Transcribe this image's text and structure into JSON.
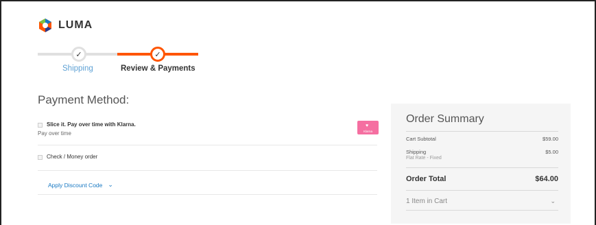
{
  "brand": {
    "name": "LUMA",
    "colors": {
      "blue": "#1979c3",
      "orange": "#ff5501",
      "green": "#7ac143",
      "navy": "#2b3a8f"
    }
  },
  "progress": {
    "steps": [
      {
        "label": "Shipping",
        "state": "complete",
        "icon": "check-icon"
      },
      {
        "label": "Review & Payments",
        "state": "current",
        "icon": "check-icon"
      }
    ]
  },
  "payment": {
    "title": "Payment Method:",
    "methods": [
      {
        "label": "Slice it. Pay over time with Klarna.",
        "sublabel": "Pay over time",
        "badge": "Klarna"
      },
      {
        "label": "Check / Money order"
      }
    ],
    "discount_label": "Apply Discount Code"
  },
  "summary": {
    "title": "Order Summary",
    "subtotal_label": "Cart Subtotal",
    "subtotal_value": "$59.00",
    "shipping_label": "Shipping",
    "shipping_sub": "Flat Rate - Fixed",
    "shipping_value": "$5.00",
    "total_label": "Order Total",
    "total_value": "$64.00",
    "cart_label": "1 Item in Cart"
  }
}
